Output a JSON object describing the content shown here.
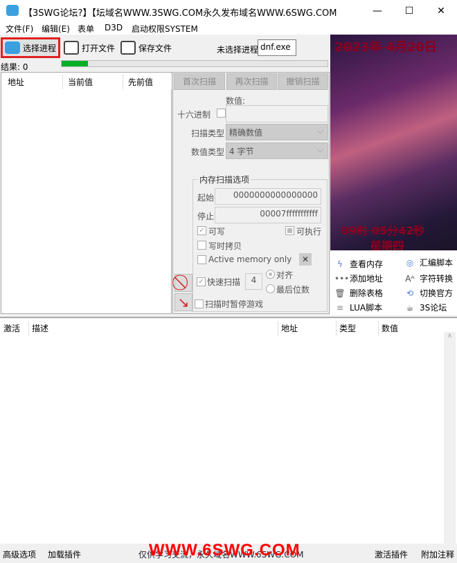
{
  "window": {
    "title": "【3SWG论坛?】【坛域名WWW.3SWG.COM永久发布域名WWW.6SWG.COM",
    "minimize": "—",
    "maximize": "☐",
    "close": "✕"
  },
  "menu": [
    "文件(F)",
    "编辑(E)",
    "表单",
    "D3D",
    "启动权限SYSTEM"
  ],
  "toolbar": {
    "select_process": "选择进程",
    "open_file": "打开文件",
    "save_file": "保存文件",
    "process_label": "未选择进程",
    "process_value": "dnf.exe"
  },
  "results": "结果: 0",
  "progress_percent": 10,
  "left_list": {
    "columns": [
      "地址",
      "当前值",
      "先前值"
    ]
  },
  "scan": {
    "first_scan": "首次扫描",
    "next_scan": "再次扫描",
    "undo_scan": "撤销扫描",
    "value_label": "数值:",
    "hex_label": "十六进制",
    "value": "",
    "scan_type_label": "扫描类型",
    "scan_type": "精确数值",
    "value_type_label": "数值类型",
    "value_type": "4 字节",
    "mem_group": "内存扫描选项",
    "start_label": "起始",
    "start": "0000000000000000",
    "stop_label": "停止",
    "stop": "00007fffffffffff",
    "writable": "可写",
    "executable": "可执行",
    "copy_on_write": "写时拷贝",
    "active_memory": "Active memory only",
    "fast_scan": "快速扫描",
    "fast_scan_value": "4",
    "aligned": "对齐",
    "last_digits": "最后位数",
    "pause_game": "扫描时暂停游戏"
  },
  "banner": {
    "date": "2023年 4月20日",
    "time": "09时 05分42秒",
    "weekday": "星期四"
  },
  "tools": [
    {
      "label": "查看内存",
      "icon": "lightning-icon"
    },
    {
      "label": "汇编脚本",
      "icon": "target-icon"
    },
    {
      "label": "添加地址",
      "icon": "dots-icon"
    },
    {
      "label": "字符转换",
      "icon": "font-icon"
    },
    {
      "label": "删除表格",
      "icon": "trash-icon"
    },
    {
      "label": "切换官方",
      "icon": "refresh-icon"
    },
    {
      "label": "LUA脚本",
      "icon": "list-icon"
    },
    {
      "label": "3S论坛",
      "icon": "cup-icon"
    }
  ],
  "table": {
    "columns": [
      "激活",
      "描述",
      "地址",
      "类型",
      "数值"
    ]
  },
  "footer": {
    "advanced": "高级选项",
    "load_plugin": "加载插件",
    "notice": "仅供学习交流，永久域名WWW.6SWG.COM",
    "activate_plugin": "激活插件",
    "add_comment": "附加注释",
    "watermark": "WWW.6SWG.COM"
  }
}
